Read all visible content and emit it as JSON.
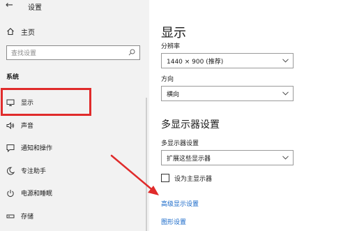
{
  "window": {
    "title": "设置"
  },
  "sidebar": {
    "home_label": "主页",
    "search_placeholder": "查找设置",
    "group_header": "系统",
    "items": [
      {
        "label": "显示",
        "icon": "monitor-icon",
        "selected": true
      },
      {
        "label": "声音",
        "icon": "speaker-icon"
      },
      {
        "label": "通知和操作",
        "icon": "notification-icon"
      },
      {
        "label": "专注助手",
        "icon": "moon-icon"
      },
      {
        "label": "电源和睡眠",
        "icon": "power-icon"
      },
      {
        "label": "存储",
        "icon": "storage-icon"
      }
    ]
  },
  "main": {
    "title": "显示",
    "resolution": {
      "label": "分辨率",
      "value": "1440 × 900 (推荐)"
    },
    "orientation": {
      "label": "方向",
      "value": "横向"
    },
    "multi_display": {
      "section_title": "多显示器设置",
      "label": "多显示器设置",
      "value": "扩展这些显示器",
      "checkbox_label": "设为主显示器",
      "checkbox_checked": false
    },
    "links": {
      "advanced": "高级显示设置",
      "graphics": "图形设置"
    }
  },
  "colors": {
    "highlight": "#e02b2b",
    "link": "#1667c8",
    "sidebar_bg": "#f2f2f2"
  }
}
